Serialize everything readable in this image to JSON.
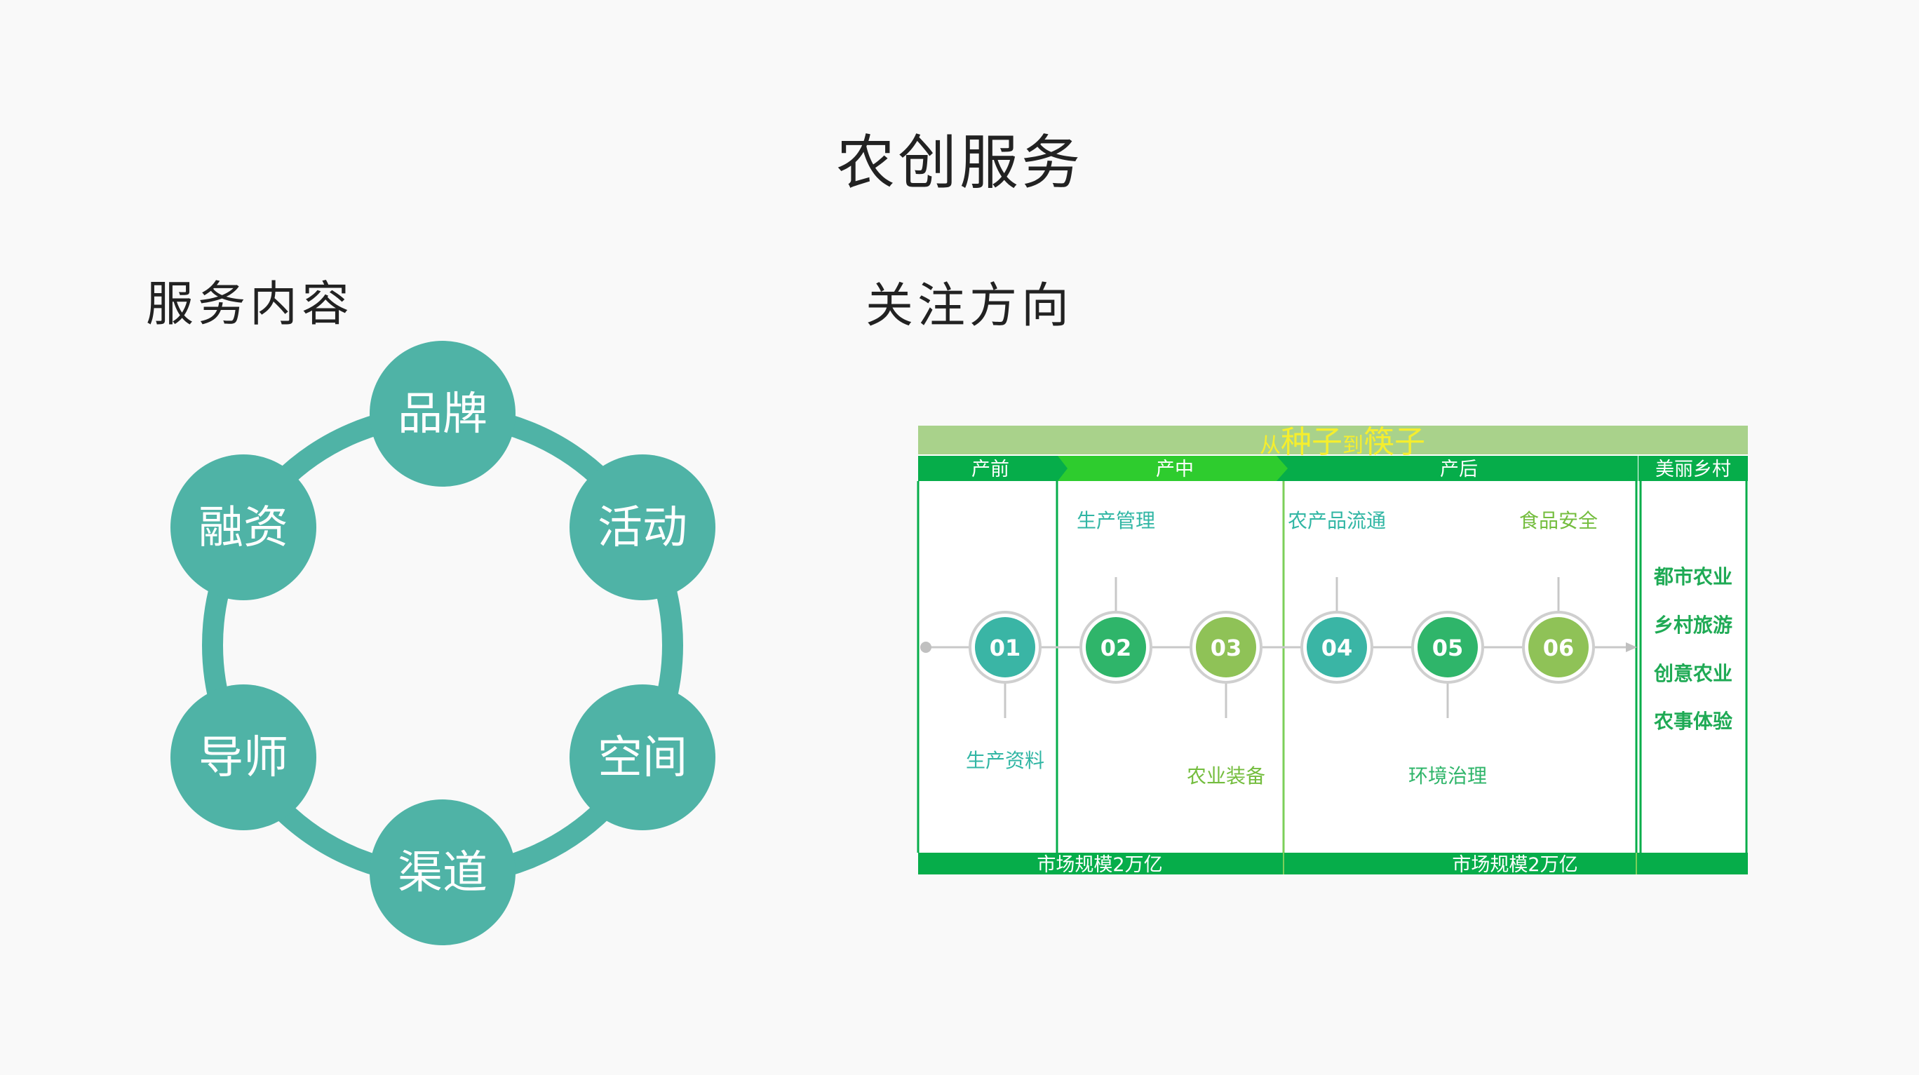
{
  "page": {
    "title": "农创服务",
    "left_heading": "服务内容",
    "right_heading": "关注方向"
  },
  "services_cycle": {
    "ring_color": "#4fb3a6",
    "nodes": [
      "品牌",
      "活动",
      "空间",
      "渠道",
      "导师",
      "融资"
    ]
  },
  "focus_diagram": {
    "banner": {
      "small1": "从",
      "big1": "种子",
      "small2": "到",
      "big2": "筷子"
    },
    "stages": [
      "产前",
      "产中",
      "产后"
    ],
    "side_header": "美丽乡村",
    "side_items": [
      "都市农业",
      "乡村旅游",
      "创意农业",
      "农事体验"
    ],
    "steps": [
      {
        "num": "01",
        "label": "生产资料",
        "color": "#3ab5a5"
      },
      {
        "num": "02",
        "label": "生产管理",
        "color": "#2fb56a"
      },
      {
        "num": "03",
        "label": "农业装备",
        "color": "#8fc257"
      },
      {
        "num": "04",
        "label": "农产品流通",
        "color": "#3ab5a5"
      },
      {
        "num": "05",
        "label": "环境治理",
        "color": "#2fb56a"
      },
      {
        "num": "06",
        "label": "食品安全",
        "color": "#8fc257"
      }
    ],
    "market_labels": [
      "市场规模2万亿",
      "市场规模2万亿"
    ],
    "colors": {
      "banner_bg": "#a9d28b",
      "banner_text": "#f5ee2e",
      "stage_dark": "#06ad4a",
      "stage_light": "#2ecc2e",
      "teal_text": "#31b6a4",
      "green_text": "#74bd3e"
    }
  }
}
